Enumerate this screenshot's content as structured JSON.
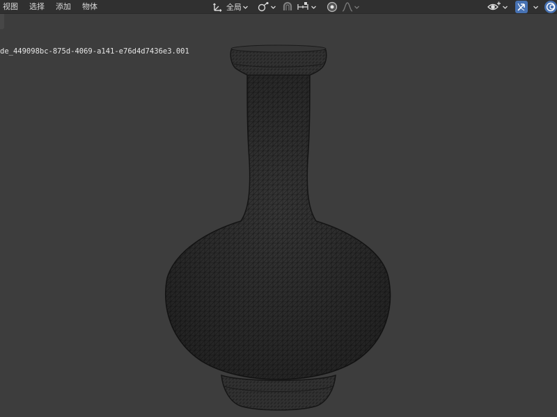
{
  "header": {
    "menu": [
      "视图",
      "选择",
      "添加",
      "物体"
    ],
    "transform_orientation_label": "全局"
  },
  "icons": {
    "orientation": "transform-orientation-icon",
    "pivot": "pivot-point-icon",
    "snap": "snap-magnet-icon",
    "snap_increment": "snap-increment-icon",
    "proportional": "proportional-edit-icon",
    "falloff": "falloff-curve-icon",
    "visibility": "eye-visibility-icon",
    "gizmo": "gizmo-arrow-icon",
    "overlay": "overlay-icon"
  },
  "colors": {
    "viewport_bg": "#3d3d3d",
    "header_bg": "#303030",
    "active_blue": "#4772b3",
    "mesh_fill": "#3a3a3a",
    "wire": "#141414"
  },
  "viewport": {
    "object_name": "de_449098bc-875d-4069-a141-e76d4d7436e3.001"
  }
}
